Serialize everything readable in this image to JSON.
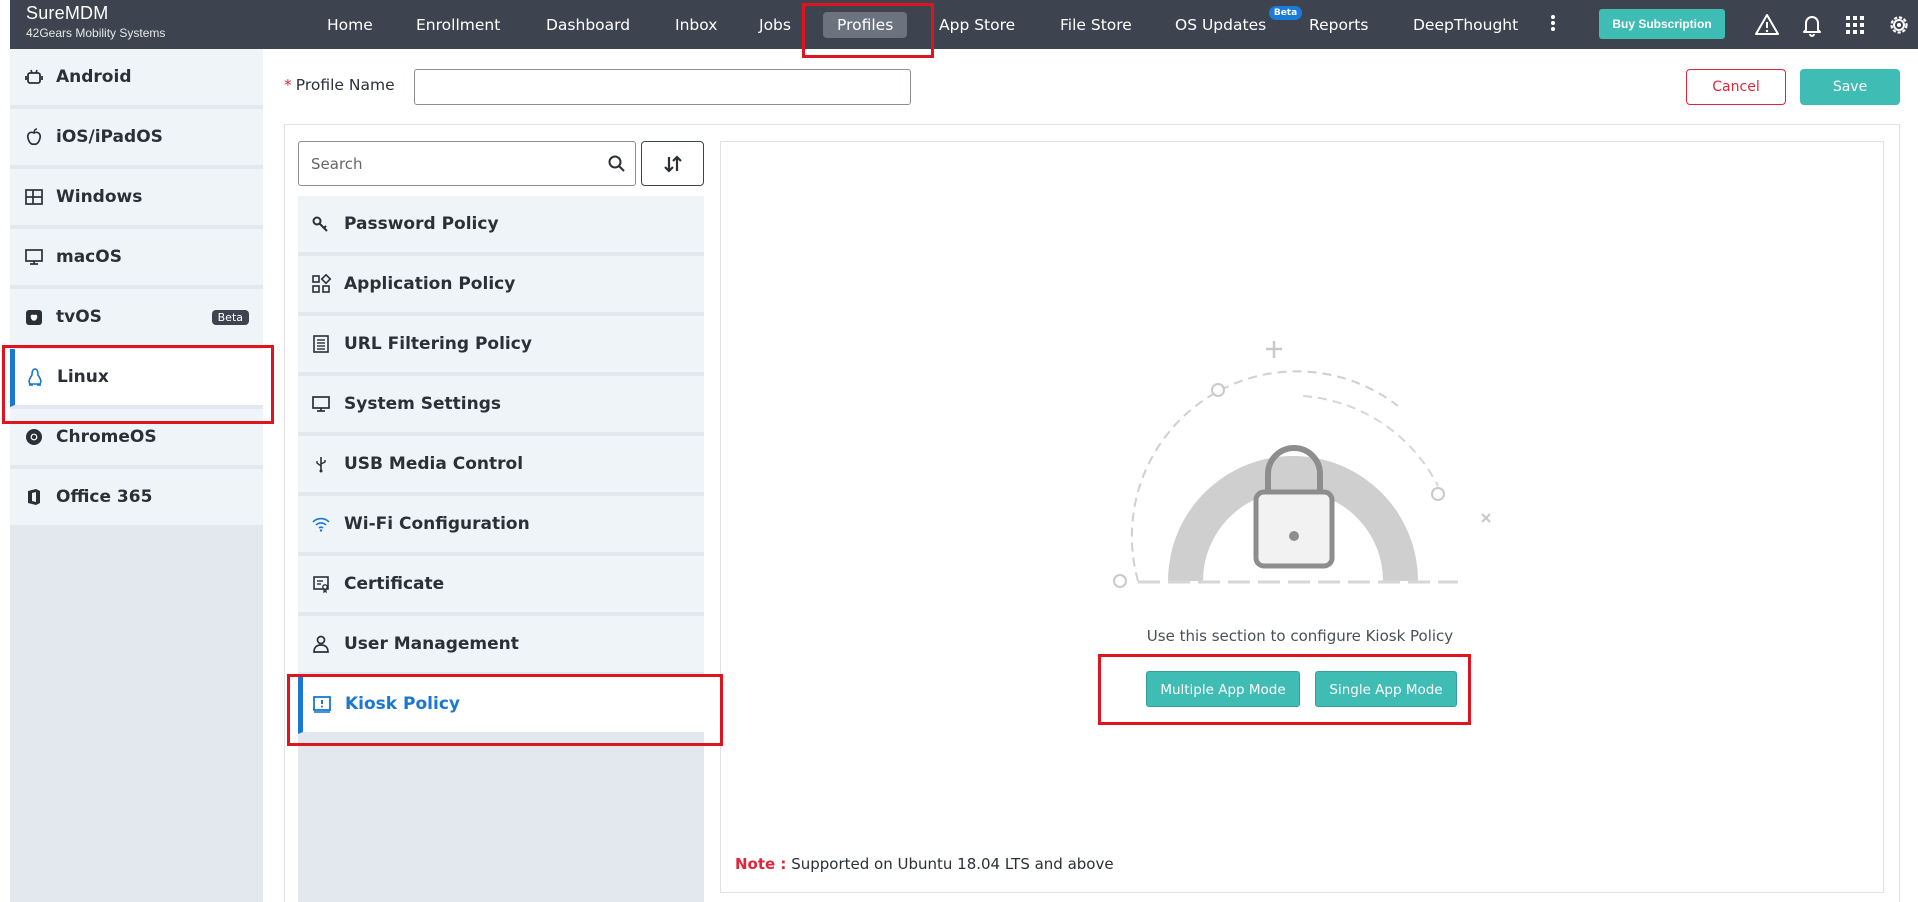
{
  "app": {
    "name": "SureMDM",
    "company": "42Gears Mobility Systems"
  },
  "nav": {
    "items": [
      {
        "label": "Home"
      },
      {
        "label": "Enrollment"
      },
      {
        "label": "Dashboard"
      },
      {
        "label": "Inbox"
      },
      {
        "label": "Jobs"
      },
      {
        "label": "Profiles",
        "active": true
      },
      {
        "label": "App Store"
      },
      {
        "label": "File Store"
      },
      {
        "label": "OS Updates",
        "badge": "Beta"
      },
      {
        "label": "Reports"
      },
      {
        "label": "DeepThought"
      }
    ],
    "buy_label": "Buy Subscription",
    "icons": [
      "more-icon",
      "warning-icon",
      "bell-icon",
      "apps-grid-icon",
      "gear-icon"
    ]
  },
  "os_sidebar": {
    "items": [
      {
        "label": "Android",
        "icon": "android-icon"
      },
      {
        "label": "iOS/iPadOS",
        "icon": "apple-icon"
      },
      {
        "label": "Windows",
        "icon": "windows-icon"
      },
      {
        "label": "macOS",
        "icon": "monitor-icon"
      },
      {
        "label": "tvOS",
        "icon": "tv-icon",
        "badge": "Beta"
      },
      {
        "label": "Linux",
        "icon": "linux-icon",
        "active": true
      },
      {
        "label": "ChromeOS",
        "icon": "chrome-icon"
      },
      {
        "label": "Office 365",
        "icon": "office-icon"
      }
    ]
  },
  "profile": {
    "name_label": "Profile Name",
    "required_mark": "*",
    "name_value": "",
    "cancel_label": "Cancel",
    "save_label": "Save"
  },
  "policy_panel": {
    "search_placeholder": "Search",
    "items": [
      {
        "label": "Password Policy",
        "icon": "key-icon"
      },
      {
        "label": "Application Policy",
        "icon": "apps-icon"
      },
      {
        "label": "URL Filtering Policy",
        "icon": "list-icon"
      },
      {
        "label": "System Settings",
        "icon": "monitor-icon"
      },
      {
        "label": "USB Media Control",
        "icon": "usb-icon"
      },
      {
        "label": "Wi-Fi Configuration",
        "icon": "wifi-icon"
      },
      {
        "label": "Certificate",
        "icon": "certificate-icon"
      },
      {
        "label": "User Management",
        "icon": "user-icon"
      },
      {
        "label": "Kiosk Policy",
        "icon": "kiosk-icon",
        "active": true
      }
    ]
  },
  "kiosk": {
    "description": "Use this section to configure Kiosk Policy",
    "multiple_label": "Multiple App Mode",
    "single_label": "Single App Mode",
    "note_label": "Note :",
    "note_text": "Supported on Ubuntu 18.04 LTS and above"
  },
  "colors": {
    "topbar": "#3d4450",
    "accent": "#3fbcb4",
    "active_blue": "#1a78d2",
    "danger": "#e0263d"
  }
}
